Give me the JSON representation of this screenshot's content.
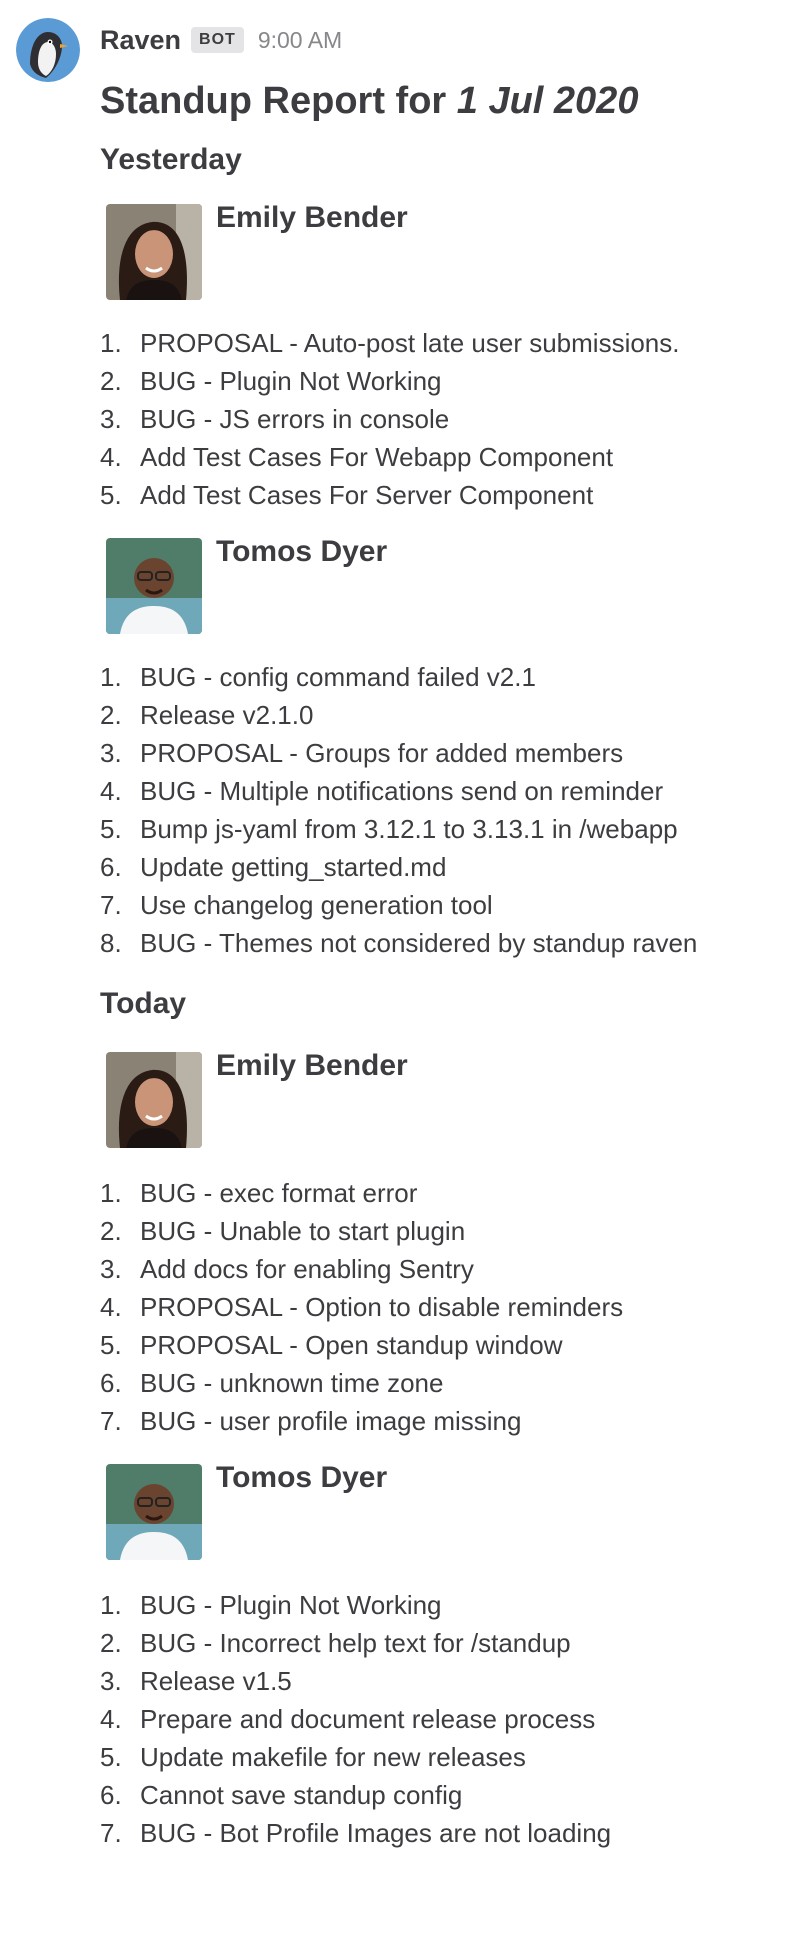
{
  "post": {
    "username": "Raven",
    "badge": "BOT",
    "timestamp": "9:00 AM",
    "title_prefix": "Standup Report for ",
    "title_date": "1 Jul 2020"
  },
  "sections": [
    {
      "heading": "Yesterday",
      "users": [
        {
          "name": "Emily Bender",
          "tasks": [
            "PROPOSAL - Auto-post late user submissions.",
            "BUG - Plugin Not Working",
            "BUG - JS errors in console",
            "Add Test Cases For Webapp Component",
            "Add Test Cases For Server Component"
          ]
        },
        {
          "name": "Tomos Dyer",
          "tasks": [
            "BUG - config command failed v2.1",
            "Release v2.1.0",
            "PROPOSAL - Groups for added members",
            "BUG - Multiple notifications send on reminder",
            "Bump js-yaml from 3.12.1 to 3.13.1 in /webapp",
            "Update getting_started.md",
            "Use changelog generation tool",
            "BUG - Themes not considered by standup raven"
          ]
        }
      ]
    },
    {
      "heading": "Today",
      "users": [
        {
          "name": "Emily Bender",
          "tasks": [
            "BUG - exec format error",
            "BUG - Unable to start plugin",
            "Add docs for enabling Sentry",
            "PROPOSAL - Option to disable reminders",
            "PROPOSAL - Open standup window",
            "BUG - unknown time zone",
            "BUG - user profile image missing"
          ]
        },
        {
          "name": "Tomos Dyer",
          "tasks": [
            "BUG - Plugin Not Working",
            "BUG - Incorrect help text for /standup",
            "Release v1.5",
            "Prepare and document release process",
            "Update makefile for new releases",
            "Cannot save standup config",
            "BUG - Bot Profile Images are not loading"
          ]
        }
      ]
    }
  ],
  "colors": {
    "text": "#3d3c40",
    "timestamp": "#88878b",
    "badge_bg": "#e4e4e6",
    "bot_avatar_bg": "#5b9bd5"
  },
  "icons": {
    "bot_avatar": "penguin-avatar-icon",
    "user_avatar": "user-photo-icon"
  }
}
